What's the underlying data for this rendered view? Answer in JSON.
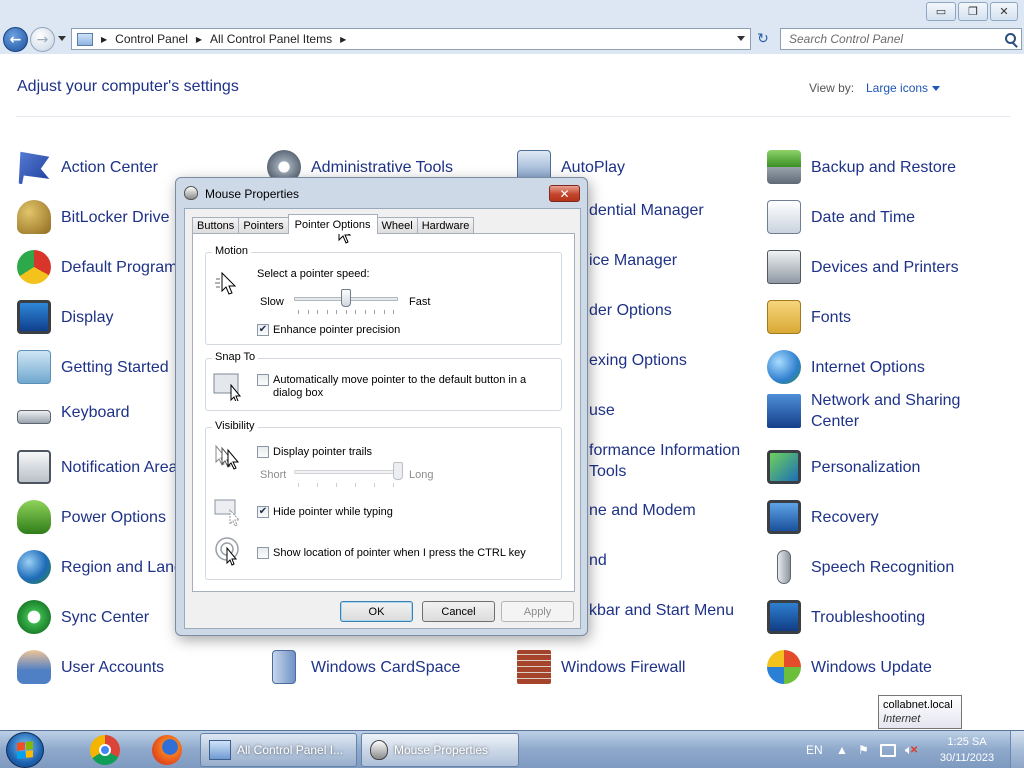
{
  "window": {
    "min_glyph": "▭",
    "max_glyph": "❐",
    "close_glyph": "✕"
  },
  "address": {
    "crumbs": [
      "Control Panel",
      "All Control Panel Items"
    ],
    "search_placeholder": "Search Control Panel"
  },
  "content": {
    "heading": "Adjust your computer's settings",
    "view_by_label": "View by:",
    "view_by_value": "Large icons"
  },
  "items": {
    "action_center": "Action Center",
    "admin_tools": "Administrative Tools",
    "autoplay": "AutoPlay",
    "backup_restore": "Backup and Restore",
    "bitlocker": "BitLocker Drive E",
    "credential": "dential Manager",
    "date_time": "Date and Time",
    "default_programs": "Default Program",
    "device_manager": "ice Manager",
    "devices_printers": "Devices and Printers",
    "display": "Display",
    "folder_options": "der Options",
    "fonts": "Fonts",
    "getting_started": "Getting Started",
    "indexing": "exing Options",
    "internet_options": "Internet Options",
    "keyboard": "Keyboard",
    "mouse": "use",
    "network_1": "Network and Sharing",
    "network_2": "Center",
    "notification": "Notification Area",
    "performance_1": "formance Information",
    "performance_2": "Tools",
    "personalization": "Personalization",
    "power": "Power Options",
    "phone_modem": "ne and Modem",
    "recovery": "Recovery",
    "region": "Region and Lang",
    "sound": "nd",
    "speech": "Speech Recognition",
    "sync": "Sync Center",
    "taskbar_start": "kbar and Start Menu",
    "troubleshooting": "Troubleshooting",
    "user_accounts": "User Accounts",
    "cardspace": "Windows CardSpace",
    "firewall": "Windows Firewall",
    "update": "Windows Update"
  },
  "dialog": {
    "title": "Mouse Properties",
    "tabs": [
      "Buttons",
      "Pointers",
      "Pointer Options",
      "Wheel",
      "Hardware"
    ],
    "active_tab": "Pointer Options",
    "motion": {
      "title": "Motion",
      "speed_label": "Select a pointer speed:",
      "slow": "Slow",
      "fast": "Fast",
      "speed_value": 0.5,
      "enhance_label": "Enhance pointer precision",
      "enhance_checked": true
    },
    "snap_to": {
      "title": "Snap To",
      "label_line1": "Automatically move pointer to the default button in a",
      "label_line2": "dialog box",
      "checked": false
    },
    "visibility": {
      "title": "Visibility",
      "trails_label": "Display pointer trails",
      "trails_checked": false,
      "short": "Short",
      "long": "Long",
      "trail_value": 1.0,
      "hide_label": "Hide pointer while typing",
      "hide_checked": true,
      "show_location_label": "Show location of pointer when I press the CTRL key",
      "show_location_checked": false
    },
    "buttons": {
      "ok": "OK",
      "cancel": "Cancel",
      "apply": "Apply"
    }
  },
  "tooltip": {
    "line1": "collabnet.local",
    "line2": "Internet access"
  },
  "taskbar": {
    "tasks": [
      {
        "label": "All Control Panel I...",
        "active": false
      },
      {
        "label": "Mouse Properties",
        "active": true
      }
    ],
    "language": "EN",
    "time": "1:25 SA",
    "date": "30/11/2023"
  },
  "colors": {
    "link_blue": "#1e3287",
    "accent_blue": "#1e56b5",
    "close_red": "#c4462d"
  }
}
